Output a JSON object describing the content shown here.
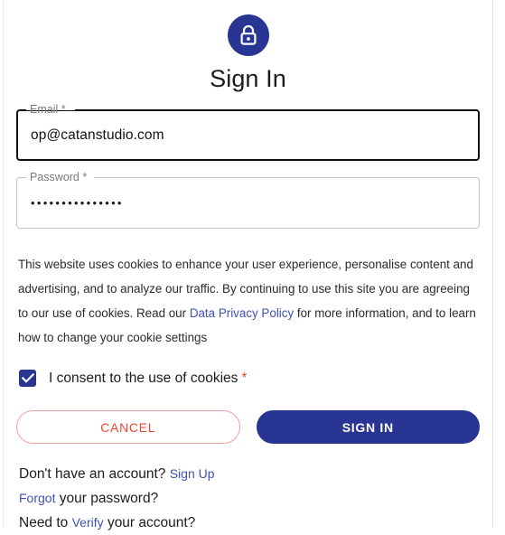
{
  "header": {
    "lock_icon": "lock-icon",
    "title": "Sign In",
    "accent_color": "#283593"
  },
  "form": {
    "email": {
      "label": "Email *",
      "value": "op@catanstudio.com",
      "placeholder": "Email",
      "focused": true
    },
    "password": {
      "label": "Password *",
      "value": "•••••••••••••••",
      "placeholder": "Password",
      "focused": false
    }
  },
  "cookie_notice": {
    "part1": "This website uses cookies to enhance your user experience, personalise content and advertising, and to analyze our traffic. By continuing to use this site you are agreeing to our use of cookies. Read our ",
    "link": "Data Privacy Policy",
    "part2": " for more information, and to learn how to change your cookie settings"
  },
  "consent": {
    "checked": true,
    "label": "I consent to the use of cookies",
    "required_marker": "*",
    "required_color": "#f44336"
  },
  "buttons": {
    "cancel": "CANCEL",
    "sign_in": "SIGN IN",
    "cancel_color": "#f44336",
    "sign_in_bg": "#283593"
  },
  "footer": {
    "signup_prefix": "Don't have an account?",
    "signup_link": "Sign Up",
    "forgot_link": "Forgot",
    "forgot_suffix": "your password?",
    "verify_prefix": "Need to",
    "verify_link": "Verify",
    "verify_suffix": "your account?",
    "link_color": "#3f51b5"
  }
}
